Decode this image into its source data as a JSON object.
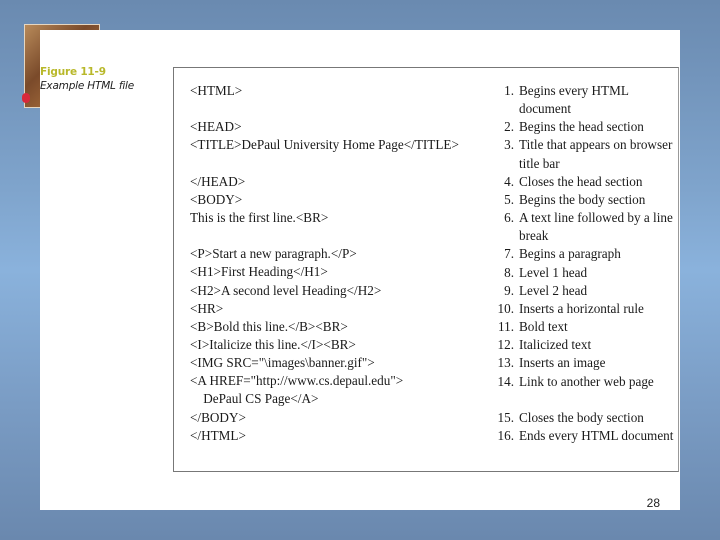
{
  "caption": {
    "figure_number": "Figure 11-9",
    "figure_title": "Example HTML file"
  },
  "code_lines": [
    "<HTML>",
    "",
    "<HEAD>",
    "<TITLE>DePaul University Home Page</TITLE>",
    "",
    "</HEAD>",
    "<BODY>",
    "This is the first line.<BR>",
    "",
    "<P>Start a new paragraph.</P>",
    "<H1>First Heading</H1>",
    "<H2>A second level Heading</H2>",
    "<HR>",
    "<B>Bold this line.</B><BR>",
    "<I>Italicize this line.</I><BR>",
    "<IMG SRC=\"\\images\\banner.gif\">",
    "<A HREF=\"http://www.cs.depaul.edu\">",
    "    DePaul CS Page</A>",
    "</BODY>",
    "</HTML>"
  ],
  "descriptions": [
    {
      "num": "1.",
      "text": "Begins every HTML document"
    },
    {
      "num": "2.",
      "text": "Begins the head section"
    },
    {
      "num": "3.",
      "text": "Title that appears on browser title bar"
    },
    {
      "num": "4.",
      "text": "Closes the head section"
    },
    {
      "num": "5.",
      "text": "Begins the body section"
    },
    {
      "num": "6.",
      "text": "A text line followed by a line break"
    },
    {
      "num": "7.",
      "text": "Begins a paragraph"
    },
    {
      "num": "8.",
      "text": "Level 1 head"
    },
    {
      "num": "9.",
      "text": "Level 2 head"
    },
    {
      "num": "10.",
      "text": "Inserts a horizontal rule"
    },
    {
      "num": "11.",
      "text": "Bold text"
    },
    {
      "num": "12.",
      "text": "Italicized text"
    },
    {
      "num": "13.",
      "text": "Inserts an image"
    },
    {
      "num": "14.",
      "text": "Link to another web page"
    },
    {
      "spacer": true
    },
    {
      "num": "15.",
      "text": "Closes the body section"
    },
    {
      "num": "16.",
      "text": "Ends every HTML document"
    }
  ],
  "page_number": "28",
  "colors": {
    "figure_number": "#b8b82a",
    "background": "#7fa4cc"
  }
}
